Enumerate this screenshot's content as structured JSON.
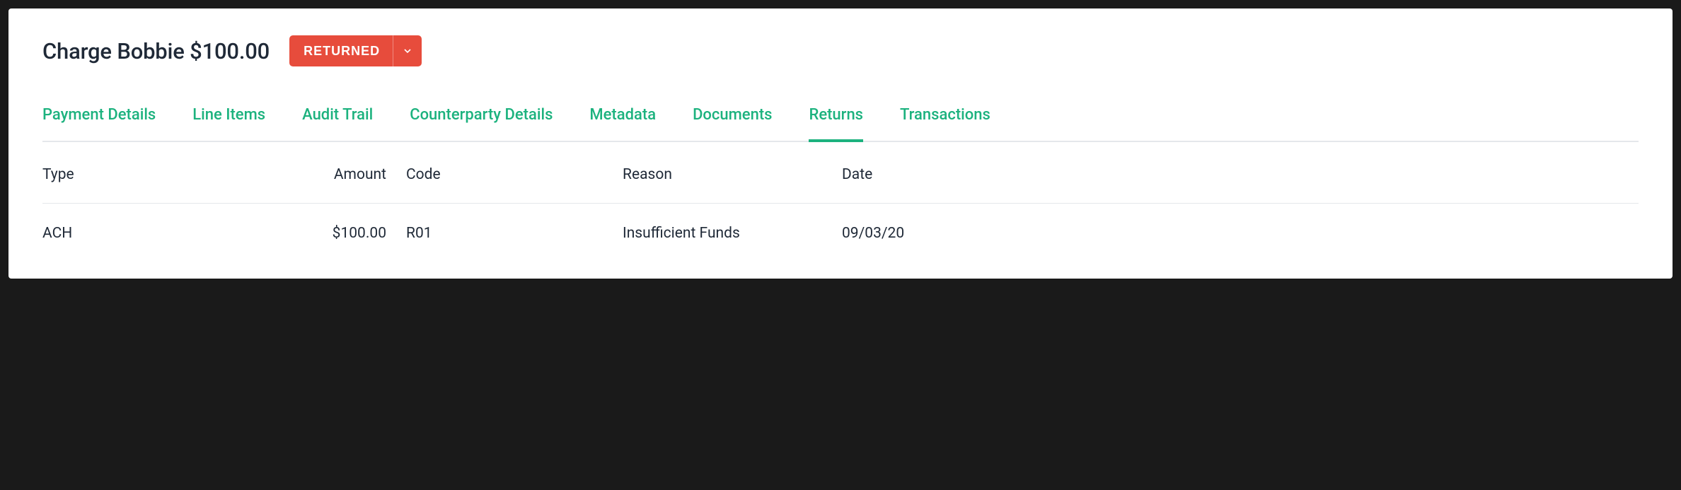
{
  "header": {
    "title": "Charge Bobbie $100.00",
    "status_label": "RETURNED"
  },
  "tabs": [
    {
      "label": "Payment Details",
      "active": false
    },
    {
      "label": "Line Items",
      "active": false
    },
    {
      "label": "Audit Trail",
      "active": false
    },
    {
      "label": "Counterparty Details",
      "active": false
    },
    {
      "label": "Metadata",
      "active": false
    },
    {
      "label": "Documents",
      "active": false
    },
    {
      "label": "Returns",
      "active": true
    },
    {
      "label": "Transactions",
      "active": false
    }
  ],
  "table": {
    "headers": {
      "type": "Type",
      "amount": "Amount",
      "code": "Code",
      "reason": "Reason",
      "date": "Date"
    },
    "rows": [
      {
        "type": "ACH",
        "amount": "$100.00",
        "code": "R01",
        "reason": "Insufficient Funds",
        "date": "09/03/20"
      }
    ]
  }
}
